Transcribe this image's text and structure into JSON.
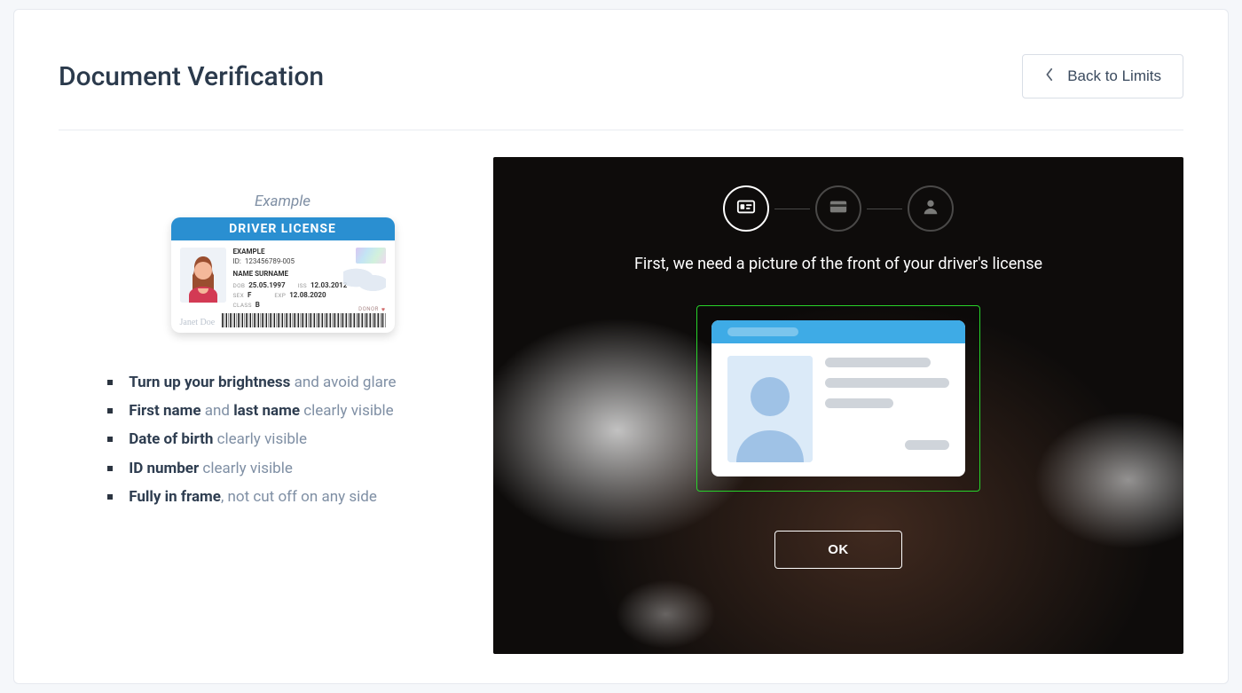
{
  "header": {
    "title": "Document Verification",
    "back_label": "Back to Limits"
  },
  "example": {
    "caption": "Example",
    "license_title": "DRIVER LICENSE",
    "fields": {
      "example_label": "EXAMPLE",
      "id_label": "ID:",
      "id_value": "123456789-005",
      "name_label": "NAME SURNAME",
      "dob_label": "DOB",
      "dob_value": "25.05.1997",
      "iss_label": "ISS",
      "iss_value": "12.03.2012",
      "sex_label": "SEX",
      "sex_value": "F",
      "exp_label": "EXP",
      "exp_value": "12.08.2020",
      "class_label": "CLASS",
      "class_value": "B",
      "donor_label": "DONOR",
      "signature": "Janet Doe"
    }
  },
  "guidelines": [
    {
      "strong1": "Turn up your brightness",
      "rest1": " and avoid glare"
    },
    {
      "strong1": "First name",
      "rest1": " and ",
      "strong2": "last name",
      "rest2": " clearly visible"
    },
    {
      "strong1": "Date of birth",
      "rest1": " clearly visible"
    },
    {
      "strong1": "ID number",
      "rest1": " clearly visible"
    },
    {
      "strong1": "Fully in frame",
      "rest1": ", not cut off on any side"
    }
  ],
  "capture": {
    "instruction": "First, we need a picture of the front of your driver's license",
    "ok_label": "OK",
    "steps": [
      "id-front",
      "id-back",
      "selfie"
    ],
    "active_step_index": 0
  }
}
